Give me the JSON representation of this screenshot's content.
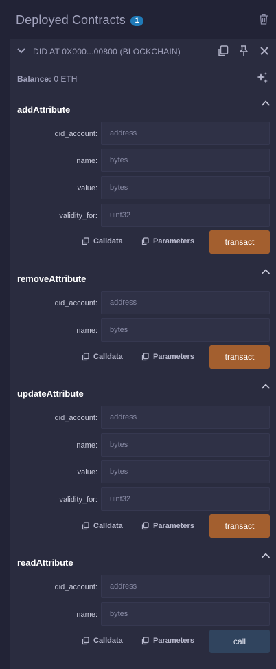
{
  "header": {
    "title": "Deployed Contracts",
    "count": "1"
  },
  "instance": {
    "title": "DID AT 0X000...00800 (BLOCKCHAIN)",
    "balance_label": "Balance:",
    "balance_value": "0 ETH"
  },
  "functions": [
    {
      "name": "addAttribute",
      "params": [
        {
          "label": "did_account:",
          "placeholder": "address"
        },
        {
          "label": "name:",
          "placeholder": "bytes"
        },
        {
          "label": "value:",
          "placeholder": "bytes"
        },
        {
          "label": "validity_for:",
          "placeholder": "uint32"
        }
      ],
      "calldata_label": "Calldata",
      "parameters_label": "Parameters",
      "button_label": "transact"
    },
    {
      "name": "removeAttribute",
      "params": [
        {
          "label": "did_account:",
          "placeholder": "address"
        },
        {
          "label": "name:",
          "placeholder": "bytes"
        }
      ],
      "calldata_label": "Calldata",
      "parameters_label": "Parameters",
      "button_label": "transact"
    },
    {
      "name": "updateAttribute",
      "params": [
        {
          "label": "did_account:",
          "placeholder": "address"
        },
        {
          "label": "name:",
          "placeholder": "bytes"
        },
        {
          "label": "value:",
          "placeholder": "bytes"
        },
        {
          "label": "validity_for:",
          "placeholder": "uint32"
        }
      ],
      "calldata_label": "Calldata",
      "parameters_label": "Parameters",
      "button_label": "transact"
    },
    {
      "name": "readAttribute",
      "params": [
        {
          "label": "did_account:",
          "placeholder": "address"
        },
        {
          "label": "name:",
          "placeholder": "bytes"
        }
      ],
      "calldata_label": "Calldata",
      "parameters_label": "Parameters",
      "button_label": "call"
    }
  ],
  "icons": {
    "trash": "trash-icon",
    "collapse": "chevron-down-icon",
    "copy": "copy-icon",
    "pin": "pin-icon",
    "close": "close-icon",
    "sparkle": "sparkle-icon",
    "section_toggle": "chevron-up-icon"
  },
  "colors": {
    "transact": "#a35f2f",
    "call": "#30445e",
    "badge": "#1f7ab8"
  }
}
